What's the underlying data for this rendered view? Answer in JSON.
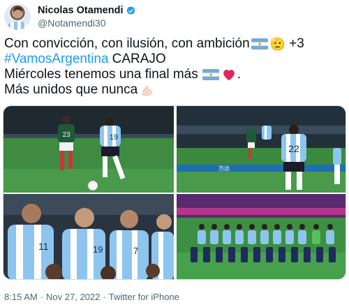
{
  "author": {
    "display_name": "Nicolas Otamendi",
    "handle": "@Notamendi30",
    "verified": true
  },
  "tweet": {
    "line1_text": "Con convicción, con ilusión, con ambición",
    "line1_more": "+3",
    "line2_hashtag": "#VamosArgentina",
    "line2_text": "CARAJO",
    "line3_text": "Miércoles tenemos una final más",
    "line3_end": ".",
    "line4_text": "Más unidos que nunca",
    "emoji_face": "🫡"
  },
  "icons": [
    "avatar",
    "verified-badge-icon",
    "argentina-flag-icon",
    "saluting-face-icon",
    "red-heart-icon",
    "flexed-biceps-icon"
  ],
  "colors": {
    "link": "#1d9bf0",
    "muted": "#536471",
    "verified": "#1d9bf0",
    "heart": "#e0245e"
  },
  "media": {
    "photos": [
      {
        "name": "mexico-vs-argentina-tackle",
        "jersey_number": "19"
      },
      {
        "name": "argentina-player-22-in-box",
        "jersey_number": "22"
      },
      {
        "name": "players-anthem-lineup",
        "jersey_numbers": [
          "11",
          "19",
          "7"
        ]
      },
      {
        "name": "team-photo-with-children"
      }
    ],
    "banner_text": "万达"
  },
  "meta": {
    "time": "8:15 AM",
    "date": "Nov 27, 2022",
    "source": "Twitter for iPhone"
  }
}
